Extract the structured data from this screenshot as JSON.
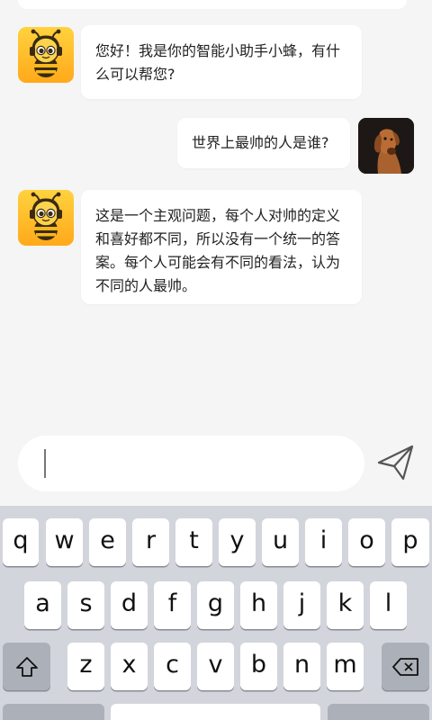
{
  "chat": {
    "messages": [
      {
        "role": "bot",
        "avatar": "bee-mascot-icon",
        "text": "您好！我是你的智能小助手小蜂，有什么可以帮您?",
        "lines": [
          "您好！我是你的智能小助手小蜂，有什",
          "么可以帮您?"
        ]
      },
      {
        "role": "user",
        "avatar": "dog-photo",
        "text": "世界上最帅的人是谁?",
        "lines": [
          "世界上最帅的人是谁?"
        ]
      },
      {
        "role": "bot",
        "avatar": "bee-mascot-icon",
        "text": "这是一个主观问题，每个人对帅的定义和喜好都不同，所以没有一个统一的答案。每个人可能会有不同的看法，认为不同的人最帅。",
        "lines": [
          "这是一个主观问题，每个人对帅的定义",
          "和喜好都不同，所以没有一个统一的答",
          "案。每个人可能会有不同的看法，认为",
          "不同的人最帅。"
        ]
      }
    ]
  },
  "composer": {
    "value": "",
    "send_icon": "send-icon"
  },
  "keyboard": {
    "row1": [
      "q",
      "w",
      "e",
      "r",
      "t",
      "y",
      "u",
      "i",
      "o",
      "p"
    ],
    "row2": [
      "a",
      "s",
      "d",
      "f",
      "g",
      "h",
      "j",
      "k",
      "l"
    ],
    "row3": [
      "z",
      "x",
      "c",
      "v",
      "b",
      "n",
      "m"
    ],
    "shift_icon": "shift-icon",
    "backspace_icon": "backspace-icon"
  },
  "colors": {
    "background": "#f5f5f5",
    "bubble": "#ffffff",
    "bee_yellow": "#ffb21e",
    "keyboard": "#d2d5db",
    "function_key": "#acb1b9"
  }
}
